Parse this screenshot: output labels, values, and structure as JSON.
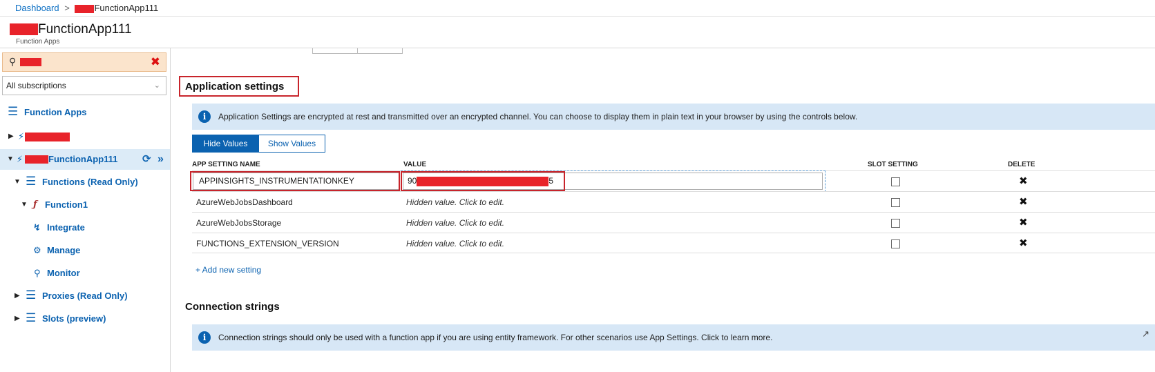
{
  "breadcrumb": {
    "home": "Dashboard",
    "sep": ">",
    "current": "FunctionApp111"
  },
  "header": {
    "title": "FunctionApp111",
    "subtitle": "Function Apps"
  },
  "sidebar": {
    "search_icon": "search-icon",
    "subscriptions": "All subscriptions",
    "function_apps": "Function Apps",
    "selected_app": "FunctionApp111",
    "functions": "Functions (Read Only)",
    "function1": "Function1",
    "integrate": "Integrate",
    "manage": "Manage",
    "monitor": "Monitor",
    "proxies": "Proxies (Read Only)",
    "slots": "Slots (preview)"
  },
  "app_settings": {
    "title": "Application settings",
    "info": "Application Settings are encrypted at rest and transmitted over an encrypted channel. You can choose to display them in plain text in your browser by using the controls below.",
    "hide_values": "Hide Values",
    "show_values": "Show Values",
    "columns": {
      "name": "APP SETTING NAME",
      "value": "VALUE",
      "slot": "SLOT SETTING",
      "delete": "DELETE"
    },
    "rows": [
      {
        "name": "APPINSIGHTS_INSTRUMENTATIONKEY",
        "value_prefix": "90",
        "value_suffix": "5"
      },
      {
        "name": "AzureWebJobsDashboard",
        "value": "Hidden value. Click to edit."
      },
      {
        "name": "AzureWebJobsStorage",
        "value": "Hidden value. Click to edit."
      },
      {
        "name": "FUNCTIONS_EXTENSION_VERSION",
        "value": "Hidden value. Click to edit."
      }
    ],
    "add_new": "+ Add new setting"
  },
  "connection_strings": {
    "title": "Connection strings",
    "info": "Connection strings should only be used with a function app if you are using entity framework. For other scenarios use App Settings. Click to learn more."
  },
  "colors": {
    "accent": "#0b62b0",
    "highlight": "#c8242b",
    "info_bg": "#d7e7f6",
    "selected_bg": "#dcebf7"
  }
}
